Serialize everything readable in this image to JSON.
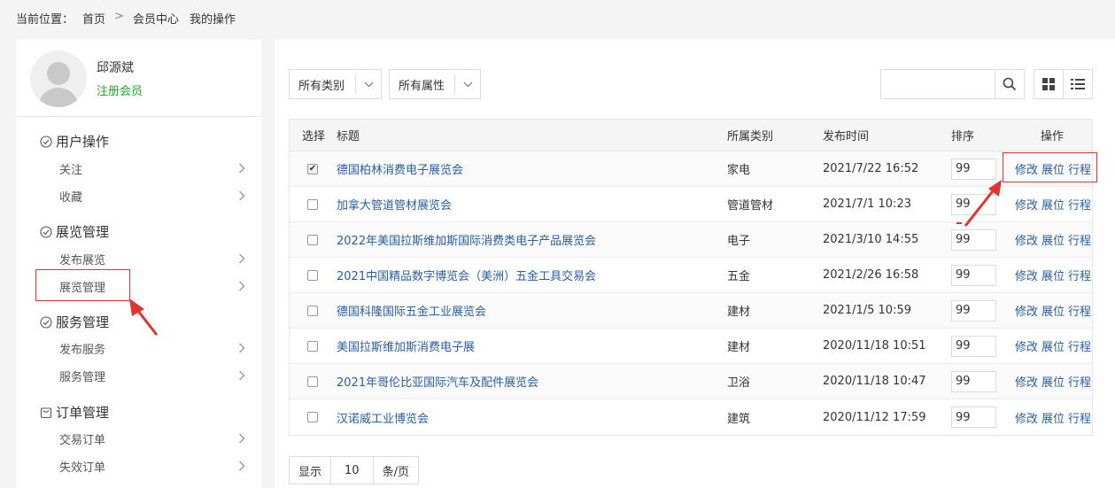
{
  "breadcrumb": {
    "label": "当前位置：",
    "items": [
      "首页",
      "会员中心",
      "我的操作"
    ],
    "separator": ">"
  },
  "user": {
    "name": "邱源斌",
    "level": "注册会员"
  },
  "sidebar": {
    "groups": [
      {
        "title": "用户操作",
        "icon": "check-circle-icon",
        "items": [
          "关注",
          "收藏"
        ]
      },
      {
        "title": "展览管理",
        "icon": "check-circle-icon",
        "items": [
          "发布展览",
          "展览管理"
        ]
      },
      {
        "title": "服务管理",
        "icon": "check-circle-icon",
        "items": [
          "发布服务",
          "服务管理"
        ]
      },
      {
        "title": "订单管理",
        "icon": "bag-icon",
        "items": [
          "交易订单",
          "失效订单"
        ]
      }
    ]
  },
  "filters": {
    "category": "所有类别",
    "attribute": "所有属性",
    "search_placeholder": ""
  },
  "table": {
    "headers": [
      "选择",
      "标题",
      "所属类别",
      "发布时间",
      "排序",
      "操作"
    ],
    "actions": [
      "修改",
      "展位",
      "行程"
    ],
    "rows": [
      {
        "checked": true,
        "title": "德国柏林消费电子展览会",
        "category": "家电",
        "time": "2021/7/22 16:52",
        "sort": "99"
      },
      {
        "checked": false,
        "title": "加拿大管道管材展览会",
        "category": "管道管材",
        "time": "2021/7/1 10:23",
        "sort": "99"
      },
      {
        "checked": false,
        "title": "2022年美国拉斯维加斯国际消费类电子产品展览会",
        "category": "电子",
        "time": "2021/3/10 14:55",
        "sort": "99"
      },
      {
        "checked": false,
        "title": "2021中国精品数字博览会（美洲）五金工具交易会",
        "category": "五金",
        "time": "2021/2/26 16:58",
        "sort": "99"
      },
      {
        "checked": false,
        "title": "德国科隆国际五金工业展览会",
        "category": "建材",
        "time": "2021/1/5 10:59",
        "sort": "99"
      },
      {
        "checked": false,
        "title": "美国拉斯维加斯消费电子展",
        "category": "建材",
        "time": "2020/11/18 10:51",
        "sort": "99"
      },
      {
        "checked": false,
        "title": "2021年哥伦比亚国际汽车及配件展览会",
        "category": "卫浴",
        "time": "2020/11/18 10:47",
        "sort": "99"
      },
      {
        "checked": false,
        "title": "汉诺威工业博览会",
        "category": "建筑",
        "time": "2020/11/12 17:59",
        "sort": "99"
      }
    ]
  },
  "pager": {
    "show_label": "显示",
    "page_size": "10",
    "unit_label": "条/页"
  },
  "colors": {
    "accent_green": "#2aa52a",
    "link_blue": "#2a5ea0",
    "highlight_red": "#e0342f"
  }
}
